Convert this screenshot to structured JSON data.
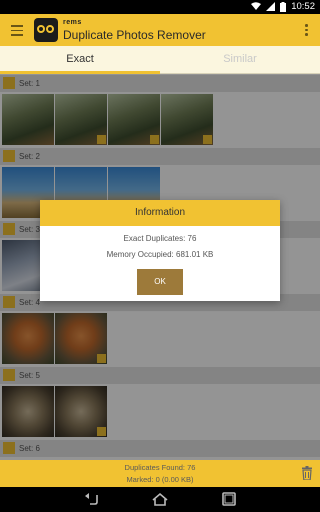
{
  "status_bar": {
    "time": "10:52",
    "icons": [
      "wifi-icon",
      "signal-icon",
      "battery-icon"
    ]
  },
  "app": {
    "brand": "rems",
    "title": "Duplicate Photos Remover",
    "accent_color": "#f1c232"
  },
  "tabs": [
    {
      "label": "Exact",
      "active": true
    },
    {
      "label": "Similar",
      "active": false
    }
  ],
  "sets": [
    {
      "label": "Set: 1",
      "thumbs": 4,
      "image": "giraffe"
    },
    {
      "label": "Set: 2",
      "thumbs": 3,
      "image": "giraffe-sky"
    },
    {
      "label": "Set: 3",
      "thumbs": 1,
      "image": "horse"
    },
    {
      "label": "Set: 4",
      "thumbs": 2,
      "image": "tiger"
    },
    {
      "label": "Set: 5",
      "thumbs": 2,
      "image": "sloth"
    },
    {
      "label": "Set: 6",
      "thumbs": 0,
      "image": ""
    }
  ],
  "dialog": {
    "title": "Information",
    "exact_duplicates": "Exact Duplicates: 76",
    "memory": "Memory Occupied: 681.01 KB",
    "ok_label": "OK"
  },
  "bottom_bar": {
    "duplicates_found": "Duplicates Found: 76",
    "marked": "Marked: 0 (0.00 KB)"
  },
  "nav_bar": {
    "buttons": [
      "back-icon",
      "home-icon",
      "recents-icon"
    ]
  }
}
